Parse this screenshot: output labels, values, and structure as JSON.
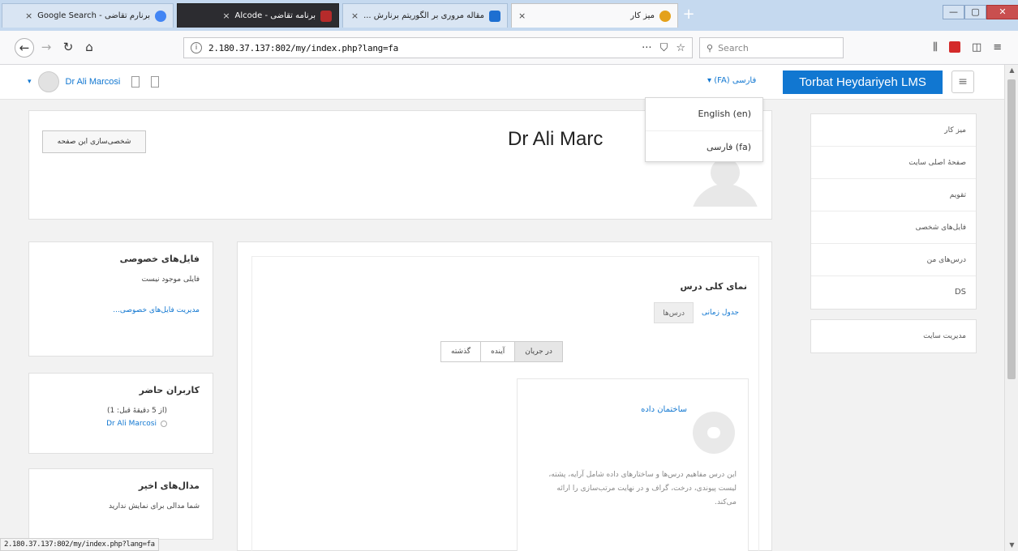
{
  "browser": {
    "tabs": [
      {
        "title": "برنارم تقاضی - Google Search",
        "close": "×",
        "color": "#4285f4"
      },
      {
        "title": "برنامه تقاضی - Alcode",
        "close": "×",
        "color": "#b52b2b"
      },
      {
        "title": "مقاله مروری بر الگوریتم برنارش ...",
        "close": "×",
        "color": "#1d6fd1"
      },
      {
        "title": "میز کار",
        "close": "×",
        "color": "#e4a11b"
      }
    ],
    "new_tab": "+",
    "window": {
      "minimize": "—",
      "maximize": "▢",
      "close": "✕"
    },
    "url": "2.180.37.137:802/my/index.php?lang=fa",
    "url_actions": [
      "···",
      "⛉",
      "☆"
    ],
    "search_placeholder": "Search",
    "status_url": "2.180.37.137:802/my/index.php?lang=fa"
  },
  "header": {
    "brand": "Torbat Heydariyeh LMS",
    "menu_icon": "≡",
    "lang_toggle": "فارسی (FA) ▾",
    "user_name": "Dr Ali Marcosi",
    "user_caret": "▾"
  },
  "lang_menu": [
    "English (en)",
    "فارسی (fa)"
  ],
  "page": {
    "title": "Dr Ali Marc",
    "customise_button": "شخصی‌سازی این صفحه"
  },
  "nav_drawer": {
    "items": [
      "میز کار",
      "صفحهٔ اصلی سایت",
      "تقویم",
      "فایل‌های شخصی",
      "درس‌های من",
      "DS"
    ],
    "admin": "مدیریت سایت"
  },
  "blocks": {
    "private_files": {
      "title": "فایل‌های خصوصی",
      "text": "فایلی موجود نیست",
      "link": "مدیریت فایل‌های خصوصی..."
    },
    "online_users": {
      "title": "کاربران حاضر",
      "text": "(از 5 دقیقهٔ قبل: 1)",
      "user": "Dr Ali Marcosi"
    },
    "latest_badges": {
      "title": "مدال‌های اخیر",
      "text": "شما مدالی برای نمایش ندارید"
    }
  },
  "overview": {
    "title": "نمای کلی درس",
    "tabs": [
      "جدول زمانی",
      "درس‌ها"
    ],
    "filters": [
      "در جریان",
      "آینده",
      "گذشته"
    ],
    "course": {
      "name": "ساختمان داده",
      "desc": "این درس مفاهیم درس‌ها و ساختارهای داده شامل آرایه، پشته، لیست پیوندی، درخت، گراف و در نهایت مرتب‌سازی را ارائه می‌کند."
    }
  },
  "colors": {
    "accent": "#1177d1",
    "tabbar": "#c5d9ef"
  }
}
